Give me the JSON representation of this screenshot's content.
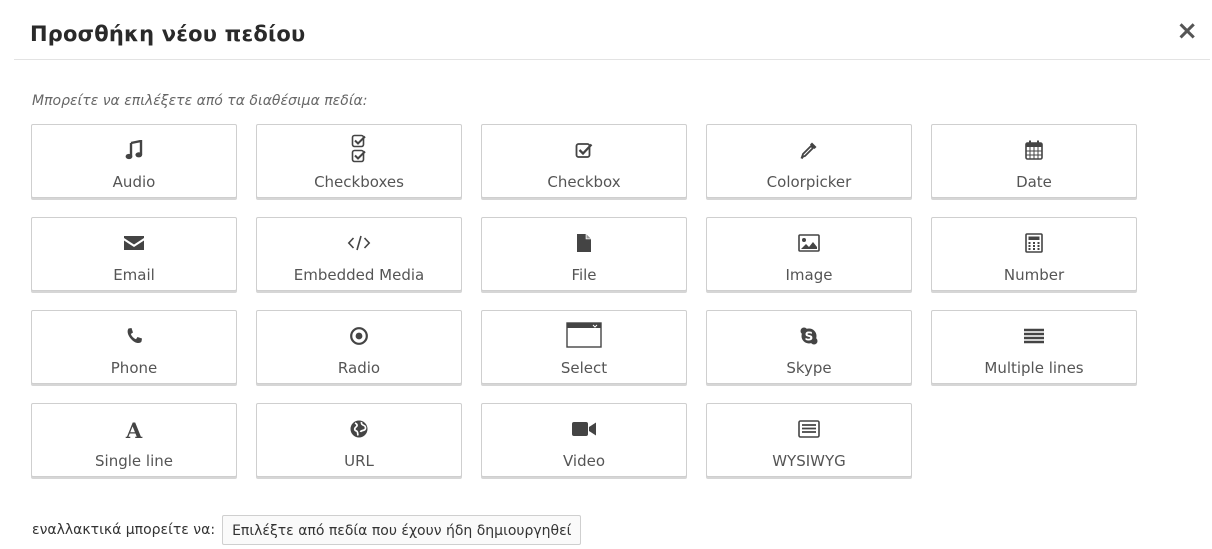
{
  "dialog": {
    "title": "Προσθήκη νέου πεδίου",
    "close_label": "×",
    "intro": "Μπορείτε να επιλέξετε από τα διαθέσιμα πεδία:"
  },
  "fields": [
    {
      "label": "Audio",
      "icon": "music-note-icon"
    },
    {
      "label": "Checkboxes",
      "icon": "checkboxes-icon"
    },
    {
      "label": "Checkbox",
      "icon": "checkbox-icon"
    },
    {
      "label": "Colorpicker",
      "icon": "eyedropper-icon"
    },
    {
      "label": "Date",
      "icon": "calendar-icon"
    },
    {
      "label": "Email",
      "icon": "envelope-icon"
    },
    {
      "label": "Embedded Media",
      "icon": "code-icon"
    },
    {
      "label": "File",
      "icon": "file-icon"
    },
    {
      "label": "Image",
      "icon": "image-icon"
    },
    {
      "label": "Number",
      "icon": "calculator-icon"
    },
    {
      "label": "Phone",
      "icon": "phone-icon"
    },
    {
      "label": "Radio",
      "icon": "radio-icon"
    },
    {
      "label": "Select",
      "icon": "select-icon"
    },
    {
      "label": "Skype",
      "icon": "skype-icon"
    },
    {
      "label": "Multiple lines",
      "icon": "lines-icon"
    },
    {
      "label": "Single line",
      "icon": "letter-a-icon"
    },
    {
      "label": "URL",
      "icon": "globe-icon"
    },
    {
      "label": "Video",
      "icon": "video-camera-icon"
    },
    {
      "label": "WYSIWYG",
      "icon": "editor-window-icon"
    }
  ],
  "footer": {
    "alt_text": "εναλλακτικά μπορείτε να:",
    "button_label": "Επιλέξτε από πεδία που έχουν ήδη δημιουργηθεί"
  },
  "colors": {
    "icon": "#444444",
    "border": "#cfcfcf"
  }
}
